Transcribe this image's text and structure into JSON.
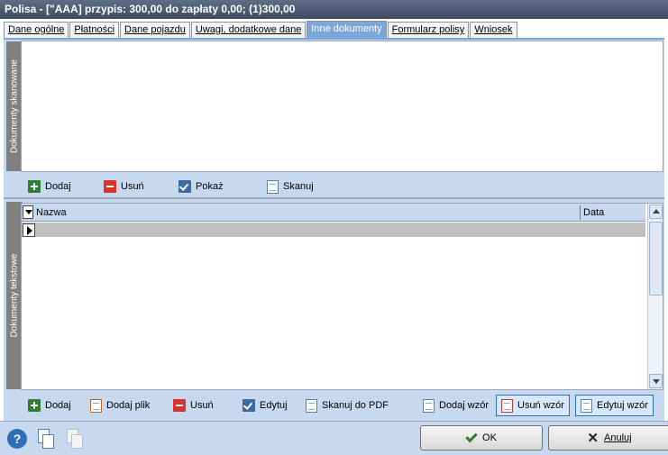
{
  "window": {
    "title": "Polisa - [\"AAA]  przypis: 300,00 do zapłaty 0,00; (1)300,00"
  },
  "tabs": [
    {
      "label": "Dane ogólne",
      "active": false
    },
    {
      "label": "Płatności",
      "active": false
    },
    {
      "label": "Dane pojazdu",
      "active": false
    },
    {
      "label": "Uwagi, dodatkowe dane",
      "active": false
    },
    {
      "label": "Inne dokumenty",
      "active": true
    },
    {
      "label": "Formularz polisy",
      "active": false
    },
    {
      "label": "Wniosek",
      "active": false
    }
  ],
  "scanned": {
    "section_label": "Dokumenty skanowane",
    "toolbar": {
      "add": "Dodaj",
      "remove": "Usuń",
      "show": "Pokaż",
      "scan": "Skanuj"
    }
  },
  "text_docs": {
    "section_label": "Dokumenty tekstowe",
    "columns": [
      "Nazwa",
      "Data"
    ],
    "toolbar": {
      "add": "Dodaj",
      "add_file": "Dodaj plik",
      "remove": "Usuń",
      "edit": "Edytuj",
      "scan_pdf": "Skanuj do PDF",
      "add_template": "Dodaj wzór",
      "remove_template": "Usuń wzór",
      "edit_template": "Edytuj wzór"
    }
  },
  "footer": {
    "ok": "OK",
    "cancel": "Anuluj"
  },
  "colors": {
    "titlebar": "#4a566c",
    "accent": "#7da7d9",
    "panel": "#c6d9ee"
  }
}
